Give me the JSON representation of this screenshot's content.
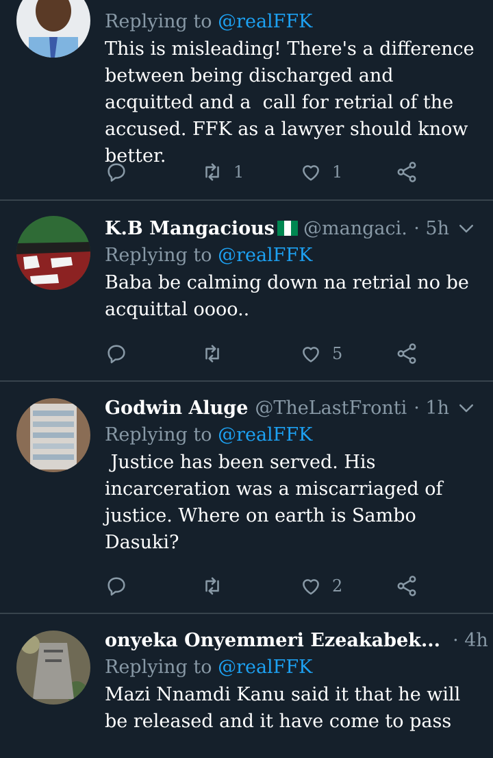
{
  "tweets": [
    {
      "name": "",
      "handle": "",
      "time": "",
      "replying_prefix": "Replying to ",
      "replying_to": "@realFFK",
      "text": "This is misleading! There's a difference between being discharged and acquitted and a  call for retrial of the accused. FFK as a lawyer should know better.",
      "reply_count": "",
      "retweet_count": "1",
      "like_count": "1"
    },
    {
      "name": "K.B Mangacious",
      "handle": "@mangaci...",
      "time": "· 5h",
      "replying_prefix": "Replying to ",
      "replying_to": "@realFFK",
      "text": "Baba be calming down na retrial no be acquittal oooo..",
      "reply_count": "",
      "retweet_count": "",
      "like_count": "5"
    },
    {
      "name": "Godwin Aluge",
      "handle": "@TheLastFronti...",
      "time": "· 1h",
      "replying_prefix": "Replying to ",
      "replying_to": "@realFFK",
      "text": " Justice has been served. His incarceration was a miscarriaged of justice. Where on earth is Sambo Dasuki?",
      "reply_count": "",
      "retweet_count": "",
      "like_count": "2"
    },
    {
      "name": "onyeka Onyemmeri Ezeakabek...",
      "handle": "",
      "time": "· 4h",
      "replying_prefix": "Replying to ",
      "replying_to": "@realFFK",
      "text": "Mazi Nnamdi Kanu said it that he will be released and it have come to pass",
      "reply_count": "",
      "retweet_count": "",
      "like_count": ""
    }
  ],
  "colors": {
    "background": "#15202b",
    "separator": "#38444d",
    "secondary_text": "#8899a6",
    "mention": "#1da1f2",
    "flag_green": "#008751",
    "flag_white": "#ffffff"
  },
  "icons": [
    "reply-icon",
    "retweet-icon",
    "like-icon",
    "share-icon",
    "chevron-down-icon",
    "nigeria-flag-icon"
  ]
}
